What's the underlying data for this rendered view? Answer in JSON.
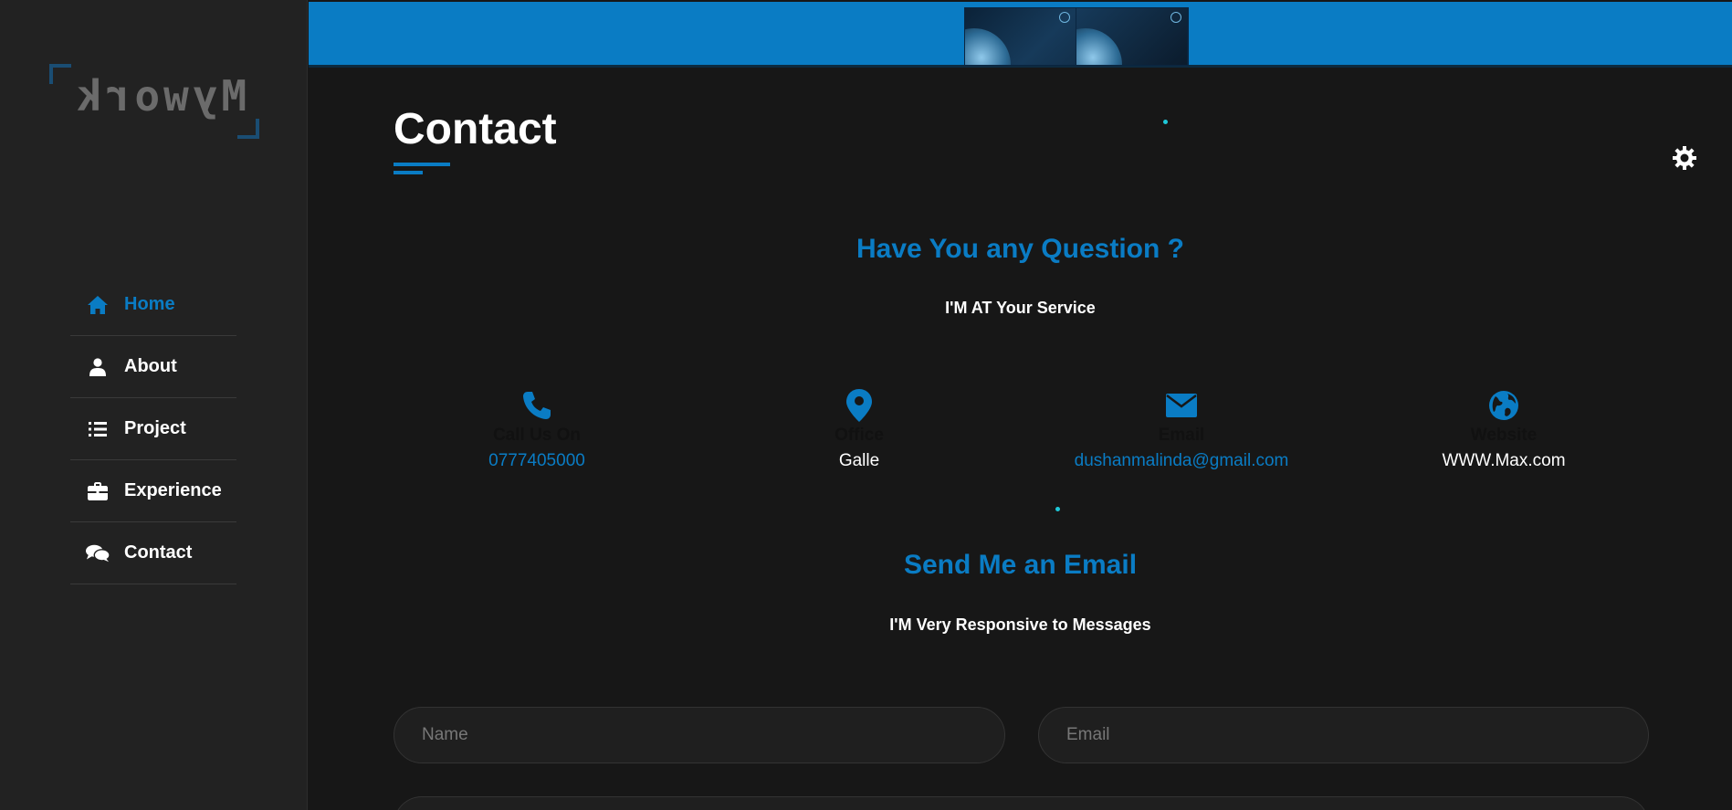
{
  "brand": {
    "logo_text": "Mywork"
  },
  "nav": {
    "items": [
      {
        "label": "Home",
        "icon": "home-icon",
        "active": true
      },
      {
        "label": "About",
        "icon": "user-icon",
        "active": false
      },
      {
        "label": "Project",
        "icon": "list-icon",
        "active": false
      },
      {
        "label": "Experience",
        "icon": "briefcase-icon",
        "active": false
      },
      {
        "label": "Contact",
        "icon": "comments-icon",
        "active": false
      }
    ]
  },
  "page": {
    "title": "Contact"
  },
  "question": {
    "heading": "Have You any Question ?",
    "subheading": "I'M AT Your Service"
  },
  "contact_info": [
    {
      "title": "Call Us On",
      "value": "0777405000",
      "icon": "phone-icon"
    },
    {
      "title": "Office",
      "value": "Galle",
      "icon": "map-marker-icon"
    },
    {
      "title": "Email",
      "value": "dushanmalinda@gmail.com",
      "icon": "envelope-icon"
    },
    {
      "title": "Website",
      "value": "WWW.Max.com",
      "icon": "globe-icon"
    }
  ],
  "email_section": {
    "heading": "Send Me an Email",
    "subheading": "I'M Very Responsive to Messages"
  },
  "form": {
    "name_placeholder": "Name",
    "email_placeholder": "Email"
  },
  "colors": {
    "accent": "#0a7cc4",
    "background": "#171717",
    "sidebar": "#222222",
    "particle": "#1ec8d8"
  }
}
